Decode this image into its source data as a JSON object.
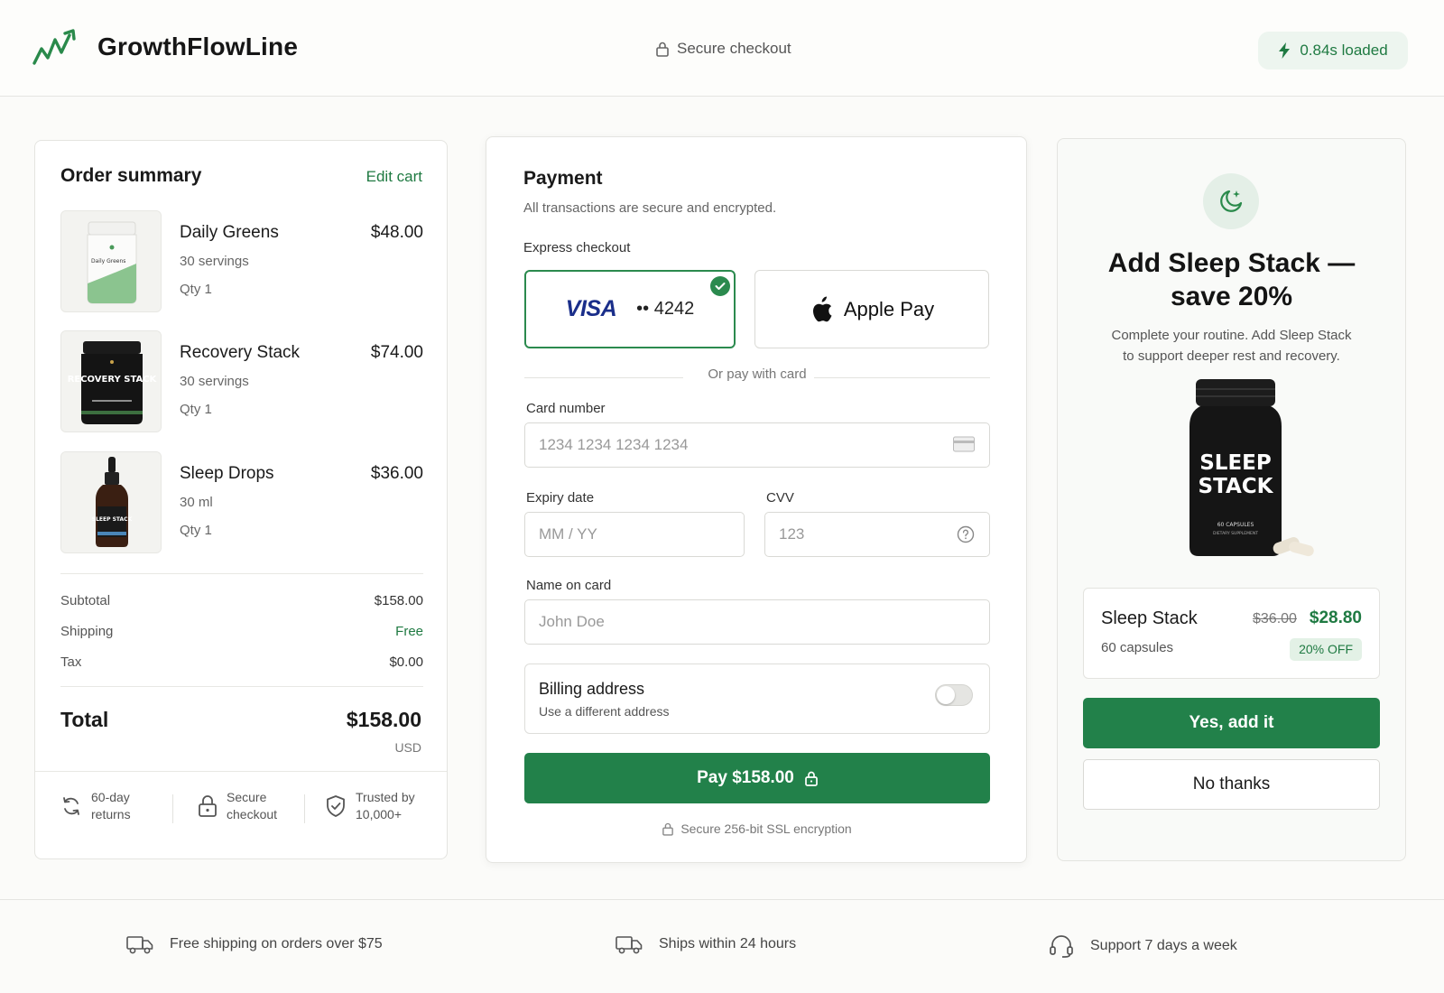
{
  "header": {
    "brand_name": "GrowthFlowLine",
    "secure_label": "Secure checkout",
    "load_time": "0.84s loaded"
  },
  "order": {
    "title": "Order summary",
    "edit_label": "Edit cart",
    "items": [
      {
        "name": "Daily Greens",
        "variant": "30 servings",
        "qty": "Qty 1",
        "price": "$48.00",
        "thumb_label": "Daily Greens"
      },
      {
        "name": "Recovery Stack",
        "variant": "30 servings",
        "qty": "Qty 1",
        "price": "$74.00",
        "thumb_label": "RECOVERY STACK"
      },
      {
        "name": "Sleep Drops",
        "variant": "30 ml",
        "qty": "Qty 1",
        "price": "$36.00",
        "thumb_label": "SLEEP STACK"
      }
    ],
    "subtotal_label": "Subtotal",
    "subtotal": "$158.00",
    "shipping_label": "Shipping",
    "shipping": "Free",
    "tax_label": "Tax",
    "tax": "$0.00",
    "total_label": "Total",
    "total": "$158.00",
    "currency": "USD",
    "trust": [
      {
        "line1": "60-day",
        "line2": "returns"
      },
      {
        "line1": "Secure",
        "line2": "checkout"
      },
      {
        "line1": "Trusted by",
        "line2": "10,000+"
      }
    ]
  },
  "payment": {
    "title": "Payment",
    "subtitle": "All transactions are secure and encrypted.",
    "express_label": "Express checkout",
    "visa_brand": "VISA",
    "visa_last4": "•• 4242",
    "apple_pay": "Apple Pay",
    "or_label": "Or pay with card",
    "card_number_label": "Card number",
    "card_number_placeholder": "1234 1234 1234 1234",
    "expiry_label": "Expiry date",
    "expiry_placeholder": "MM / YY",
    "cvv_label": "CVV",
    "cvv_placeholder": "123",
    "name_label": "Name on card",
    "name_placeholder": "John Doe",
    "billing_title": "Billing address",
    "billing_sub": "Use a different address",
    "billing_toggle_on": false,
    "pay_button": "Pay $158.00",
    "ssl_note": "Secure 256-bit SSL encryption"
  },
  "upsell": {
    "title_line1": "Add Sleep Stack —",
    "title_line2": "save 20%",
    "desc_line1": "Complete your routine. Add Sleep Stack",
    "desc_line2": "to support deeper rest and recovery.",
    "bottle_line1": "SLEEP",
    "bottle_line2": "STACK",
    "bottle_caption1": "60 CAPSULES",
    "bottle_caption2": "DIETARY SUPPLEMENT",
    "product_name": "Sleep Stack",
    "product_sub": "60 capsules",
    "old_price": "$36.00",
    "new_price": "$28.80",
    "badge": "20% OFF",
    "yes_button": "Yes, add it",
    "no_button": "No thanks"
  },
  "footer": {
    "features": [
      "Free shipping on orders over $75",
      "Ships within 24 hours",
      "Support 7 days a week"
    ]
  },
  "colors": {
    "accent": "#22814a",
    "accent_text": "#1f7a42",
    "visa_blue": "#1a2e8a"
  }
}
